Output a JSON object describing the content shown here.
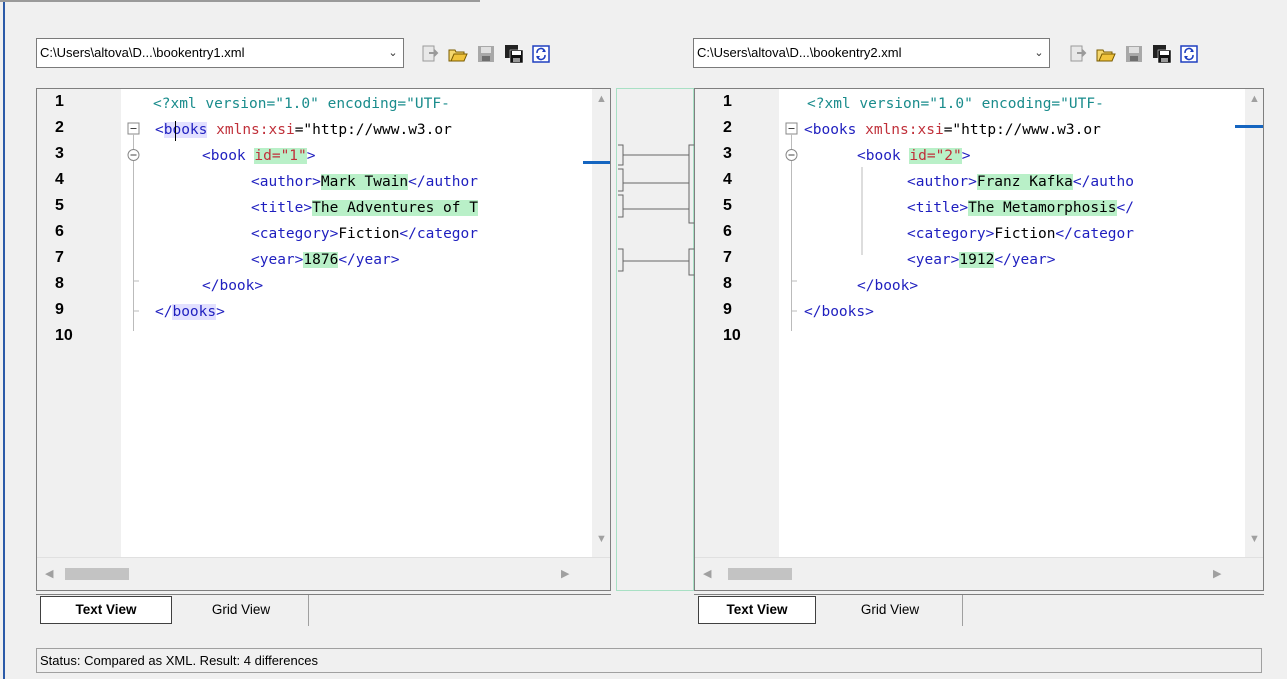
{
  "left": {
    "file_path": "C:\\Users\\altova\\D...\\bookentry1.xml",
    "toolbar_icons": [
      "open-into-icon",
      "open-folder-icon",
      "save-icon",
      "save-as-icon",
      "refresh-icon"
    ],
    "line_numbers": [
      "1",
      "2",
      "3",
      "4",
      "5",
      "6",
      "7",
      "8",
      "9",
      "10"
    ],
    "code": {
      "l1": "<?xml version=\"1.0\" encoding=\"UTF-",
      "l2_tag": "books",
      "l2_attr": "xmlns:xsi",
      "l2_val": "=\"http://www.w3.or",
      "l3_tag": "<book ",
      "l3_attr": "id=\"1\"",
      "l3_end": ">",
      "l4_open": "<author>",
      "l4_text": "Mark Twain",
      "l4_close": "</author",
      "l5_open": "<title>",
      "l5_text": "The Adventures of T",
      "l6_open": "<category>",
      "l6_text": "Fiction",
      "l6_close": "</categor",
      "l7_open": "<year>",
      "l7_text": "1876",
      "l7_close": "</year>",
      "l8": "</book>",
      "l9_open": "</",
      "l9_tag": "books",
      "l9_end": ">"
    },
    "tabs": [
      "Text View",
      "Grid View"
    ]
  },
  "right": {
    "file_path": "C:\\Users\\altova\\D...\\bookentry2.xml",
    "toolbar_icons": [
      "open-into-icon",
      "open-folder-icon",
      "save-icon",
      "save-as-icon",
      "refresh-icon"
    ],
    "line_numbers": [
      "1",
      "2",
      "3",
      "4",
      "5",
      "6",
      "7",
      "8",
      "9",
      "10"
    ],
    "code": {
      "l1": "<?xml version=\"1.0\" encoding=\"UTF-",
      "l2_tag": "<books ",
      "l2_attr": "xmlns:xsi",
      "l2_val": "=\"http://www.w3.or",
      "l3_tag": "<book ",
      "l3_attr": "id=\"2\"",
      "l3_end": ">",
      "l4_open": "<author>",
      "l4_text": "Franz Kafka",
      "l4_close": "</autho",
      "l5_open": "<title>",
      "l5_text": "The Metamorphosis",
      "l5_close": "</",
      "l6_open": "<category>",
      "l6_text": "Fiction",
      "l6_close": "</categor",
      "l7_open": "<year>",
      "l7_text": "1912",
      "l7_close": "</year>",
      "l8": "</book>",
      "l9": "</books>"
    },
    "tabs": [
      "Text View",
      "Grid View"
    ]
  },
  "status": "Status: Compared as XML. Result: 4 differences",
  "colors": {
    "diff_highlight": "#b9f0c8",
    "cursor_highlight": "#e2e0ff",
    "tag": "#1f1fbf",
    "attr": "#c0303a",
    "pi": "#1a8c8c",
    "diff_marker": "#1565c0"
  }
}
